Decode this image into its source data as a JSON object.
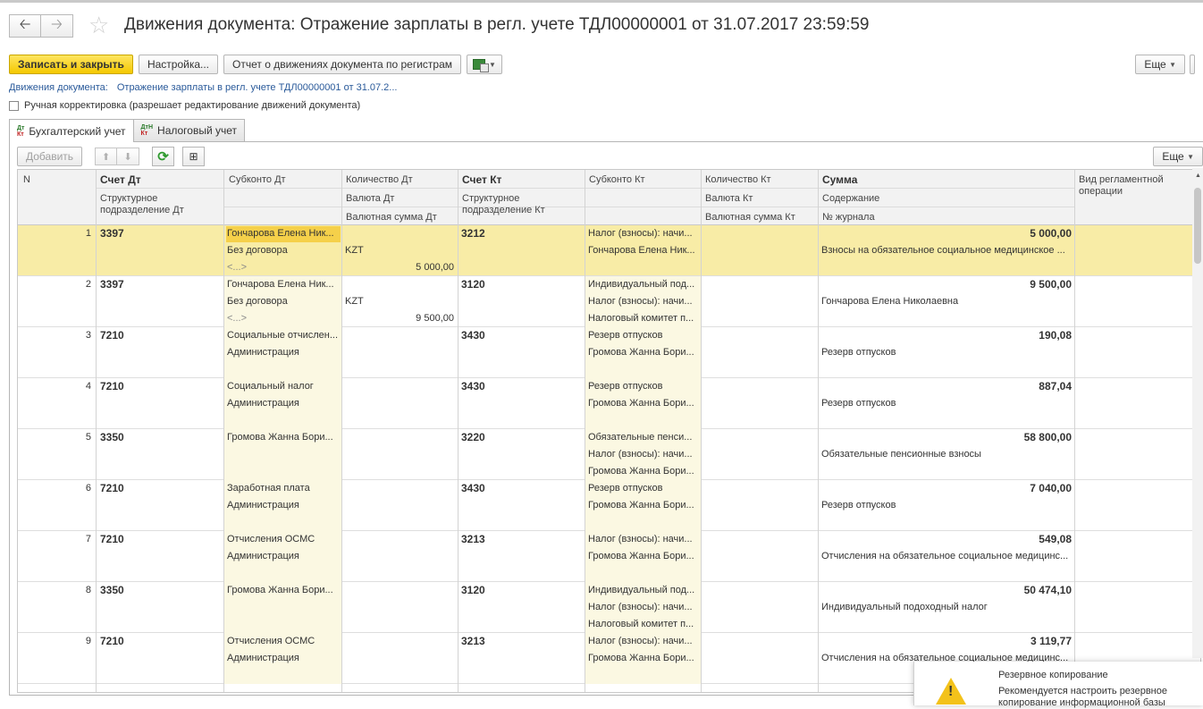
{
  "header": {
    "back_icon": "arrow-left-icon",
    "forward_icon": "arrow-right-icon",
    "title": "Движения документа: Отражение зарплаты в регл. учете ТДЛ00000001 от 31.07.2017 23:59:59"
  },
  "toolbar": {
    "save_close": "Записать и закрыть",
    "settings": "Настройка...",
    "report": "Отчет о движениях документа по регистрам",
    "more": "Еще"
  },
  "links": {
    "label": "Движения документа:",
    "doc": "Отражение зарплаты в регл. учете ТДЛ00000001 от 31.07.2..."
  },
  "manual": {
    "label": "Ручная корректировка (разрешает редактирование движений документа)",
    "checked": false
  },
  "tabs": [
    {
      "label": "Бухгалтерский учет",
      "active": true
    },
    {
      "label": "Налоговый учет",
      "active": false
    }
  ],
  "table_toolbar": {
    "add": "Добавить",
    "more": "Еще"
  },
  "columns": {
    "n": "N",
    "schet_dt": "Счет Дт",
    "subconto_dt": "Субконто Дт",
    "kol_dt": "Количество Дт",
    "schet_kt": "Счет Кт",
    "subconto_kt": "Субконто Кт",
    "kol_kt": "Количество Кт",
    "summa": "Сумма",
    "vid": "Вид регламентной операции",
    "struct_dt": "Структурное подразделение Дт",
    "valuta_dt": "Валюта Дт",
    "valsum_dt": "Валютная сумма Дт",
    "struct_kt": "Структурное подразделение Кт",
    "valuta_kt": "Валюта Кт",
    "valsum_kt": "Валютная сумма Кт",
    "soderzhanie": "Содержание",
    "zhurnal": "№ журнала"
  },
  "rows": [
    {
      "n": "1",
      "dt": "3397",
      "sdt": [
        "Гончарова Елена Ник...",
        "Без договора",
        "<...>"
      ],
      "kol_dt": [
        "",
        "KZT",
        "5 000,00"
      ],
      "kt": "3212",
      "skt": [
        "Налог (взносы): начи...",
        "Гончарова Елена Ник...",
        ""
      ],
      "sum": "5 000,00",
      "desc": "Взносы на обязательное социальное медицинское ..."
    },
    {
      "n": "2",
      "dt": "3397",
      "sdt": [
        "Гончарова Елена Ник...",
        "Без договора",
        "<...>"
      ],
      "kol_dt": [
        "",
        "KZT",
        "9 500,00"
      ],
      "kt": "3120",
      "skt": [
        "Индивидуальный под...",
        "Налог (взносы): начи...",
        "Налоговый комитет п..."
      ],
      "sum": "9 500,00",
      "desc": "Гончарова Елена Николаевна"
    },
    {
      "n": "3",
      "dt": "7210",
      "sdt": [
        "Социальные отчислен...",
        "Администрация",
        ""
      ],
      "kol_dt": [
        "",
        "",
        ""
      ],
      "kt": "3430",
      "skt": [
        "Резерв отпусков",
        "Громова Жанна Бори...",
        ""
      ],
      "sum": "190,08",
      "desc": "Резерв отпусков"
    },
    {
      "n": "4",
      "dt": "7210",
      "sdt": [
        "Социальный налог",
        "Администрация",
        ""
      ],
      "kol_dt": [
        "",
        "",
        ""
      ],
      "kt": "3430",
      "skt": [
        "Резерв отпусков",
        "Громова Жанна Бори...",
        ""
      ],
      "sum": "887,04",
      "desc": "Резерв отпусков"
    },
    {
      "n": "5",
      "dt": "3350",
      "sdt": [
        "Громова Жанна Бори...",
        "",
        ""
      ],
      "kol_dt": [
        "",
        "",
        ""
      ],
      "kt": "3220",
      "skt": [
        "Обязательные пенси...",
        "Налог (взносы): начи...",
        "Громова Жанна Бори..."
      ],
      "sum": "58 800,00",
      "desc": "Обязательные пенсионные взносы"
    },
    {
      "n": "6",
      "dt": "7210",
      "sdt": [
        "Заработная плата",
        "Администрация",
        ""
      ],
      "kol_dt": [
        "",
        "",
        ""
      ],
      "kt": "3430",
      "skt": [
        "Резерв отпусков",
        "Громова Жанна Бори...",
        ""
      ],
      "sum": "7 040,00",
      "desc": "Резерв отпусков"
    },
    {
      "n": "7",
      "dt": "7210",
      "sdt": [
        "Отчисления ОСМС",
        "Администрация",
        ""
      ],
      "kol_dt": [
        "",
        "",
        ""
      ],
      "kt": "3213",
      "skt": [
        "Налог (взносы): начи...",
        "Громова Жанна Бори...",
        ""
      ],
      "sum": "549,08",
      "desc": "Отчисления на обязательное социальное медицинс..."
    },
    {
      "n": "8",
      "dt": "3350",
      "sdt": [
        "Громова Жанна Бори...",
        "",
        ""
      ],
      "kol_dt": [
        "",
        "",
        ""
      ],
      "kt": "3120",
      "skt": [
        "Индивидуальный под...",
        "Налог (взносы): начи...",
        "Налоговый комитет п..."
      ],
      "sum": "50 474,10",
      "desc": "Индивидуальный подоходный налог"
    },
    {
      "n": "9",
      "dt": "7210",
      "sdt": [
        "Отчисления ОСМС",
        "Администрация",
        ""
      ],
      "kol_dt": [
        "",
        "",
        ""
      ],
      "kt": "3213",
      "skt": [
        "Налог (взносы): начи...",
        "Громова Жанна Бори...",
        ""
      ],
      "sum": "3 119,77",
      "desc": "Отчисления на обязательное социальное медицинс..."
    }
  ],
  "notification": {
    "icon": "warning-icon",
    "title": "Резервное копирование",
    "text": "Рекомендуется настроить резервное копирование информационной базы"
  }
}
